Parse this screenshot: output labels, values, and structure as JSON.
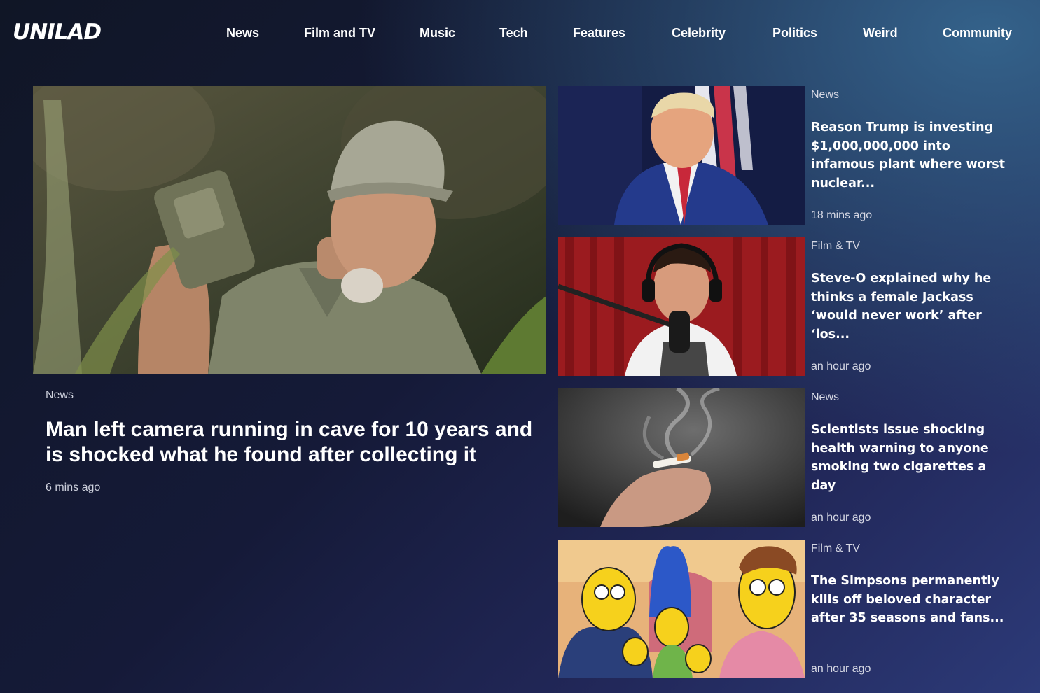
{
  "header": {
    "logo": "UNILAD",
    "nav": [
      "News",
      "Film and TV",
      "Music",
      "Tech",
      "Features",
      "Celebrity",
      "Politics",
      "Weird",
      "Community"
    ]
  },
  "hero": {
    "category": "News",
    "title": "Man left camera running in cave for 10 years and is shocked what he found after collecting it",
    "time": "6 mins ago",
    "image_icon": "man-with-trail-camera-photo"
  },
  "cards": [
    {
      "category": "News",
      "title": "Reason Trump is investing $1,000,000,000 into infamous plant where worst nuclear...",
      "time": "18 mins ago",
      "image_icon": "politician-portrait-photo"
    },
    {
      "category": "Film & TV",
      "title": "Steve-O explained why he thinks a female Jackass ‘would never work’ after ‘los...",
      "time": "an hour ago",
      "image_icon": "podcast-guest-photo"
    },
    {
      "category": "News",
      "title": "Scientists issue shocking health warning to anyone smoking two cigarettes a day",
      "time": "an hour ago",
      "image_icon": "hand-holding-cigarette-photo"
    },
    {
      "category": "Film & TV",
      "title": "The Simpsons permanently kills off beloved character after 35 seasons and fans...",
      "time": "an hour ago",
      "image_icon": "cartoon-family-still"
    }
  ],
  "colors": {
    "background_dark": "#101626",
    "background_accent": "#2c3a78",
    "meta_text": "#cdd0dc"
  }
}
